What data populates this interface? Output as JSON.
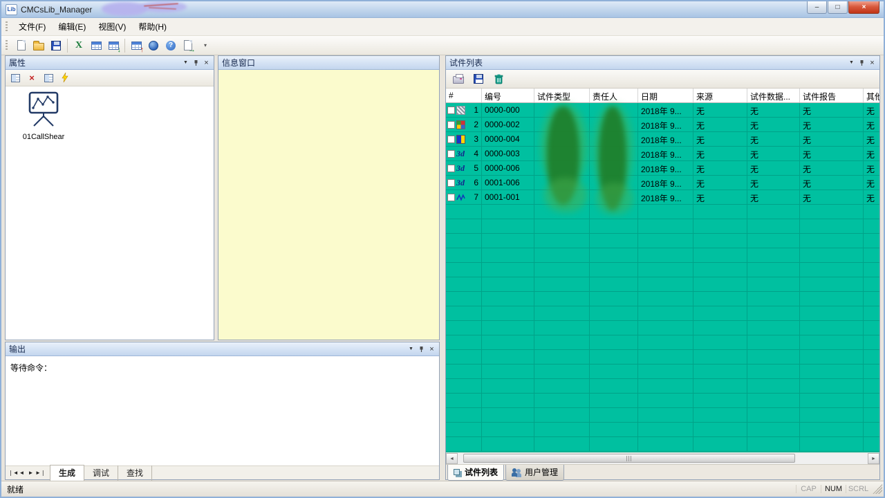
{
  "window": {
    "app_icon": "Lib",
    "title": "CMCsLib_Manager",
    "controls": {
      "minimize": "–",
      "maximize": "□",
      "close": "×"
    }
  },
  "menu": {
    "items": [
      {
        "label": "文件(F)"
      },
      {
        "label": "编辑(E)"
      },
      {
        "label": "视图(V)"
      },
      {
        "label": "帮助(H)"
      }
    ]
  },
  "panels": {
    "properties": {
      "title": "属性",
      "item_label": "01CallShear"
    },
    "info": {
      "title": "信息窗口"
    },
    "output": {
      "title": "输出",
      "text": "等待命令：",
      "tabs": [
        {
          "label": "生成",
          "active": true
        },
        {
          "label": "调试",
          "active": false
        },
        {
          "label": "查找",
          "active": false
        }
      ]
    },
    "specimens": {
      "title": "试件列表",
      "columns": [
        "#",
        "编号",
        "试件类型",
        "责任人",
        "日期",
        "来源",
        "试件数据...",
        "试件报告",
        "其他"
      ],
      "rows": [
        {
          "num": "1",
          "icon": "hatch-icon",
          "id": "0000-000",
          "type": "",
          "owner": "",
          "date": "2018年 9...",
          "source": "无",
          "data": "无",
          "report": "无",
          "other": "无"
        },
        {
          "num": "2",
          "icon": "color-grid-icon",
          "id": "0000-002",
          "type": "",
          "owner": "",
          "date": "2018年 9...",
          "source": "无",
          "data": "无",
          "report": "无",
          "other": "无"
        },
        {
          "num": "3",
          "icon": "blue-yellow-icon",
          "id": "0000-004",
          "type": "",
          "owner": "",
          "date": "2018年 9...",
          "source": "无",
          "data": "无",
          "report": "无",
          "other": "无"
        },
        {
          "num": "4",
          "icon": "3d-icon",
          "icon_text": "3d",
          "id": "0000-003",
          "type": "",
          "owner": "",
          "date": "2018年 9...",
          "source": "无",
          "data": "无",
          "report": "无",
          "other": "无"
        },
        {
          "num": "5",
          "icon": "3d-icon",
          "icon_text": "3d",
          "id": "0000-006",
          "type": "",
          "owner": "",
          "date": "2018年 9...",
          "source": "无",
          "data": "无",
          "report": "无",
          "other": "无"
        },
        {
          "num": "6",
          "icon": "3d-icon",
          "icon_text": "3d",
          "id": "0001-006",
          "type": "",
          "owner": "",
          "date": "2018年 9...",
          "source": "无",
          "data": "无",
          "report": "无",
          "other": "无"
        },
        {
          "num": "7",
          "icon": "wave-icon",
          "id": "0001-001",
          "type": "",
          "owner": "",
          "date": "2018年 9...",
          "source": "无",
          "data": "无",
          "report": "无",
          "other": "无"
        }
      ],
      "bottom_tabs": [
        {
          "label": "试件列表",
          "active": true
        },
        {
          "label": "用户管理",
          "active": false
        }
      ]
    }
  },
  "statusbar": {
    "ready": "就绪",
    "keys": [
      {
        "label": "CAP",
        "active": false
      },
      {
        "label": "NUM",
        "active": true
      },
      {
        "label": "SCRL",
        "active": false
      }
    ]
  },
  "colors": {
    "table_bg": "#00c0a0",
    "table_grid": "#00a288",
    "header_grad_top": "#e9f1fb",
    "header_grad_bottom": "#c3d6ee",
    "redaction_green_core": "#1d7c28",
    "redaction_green_halo": "#49b04f",
    "redaction_lavender": "#b7b3ee",
    "redaction_red": "#c05050"
  }
}
